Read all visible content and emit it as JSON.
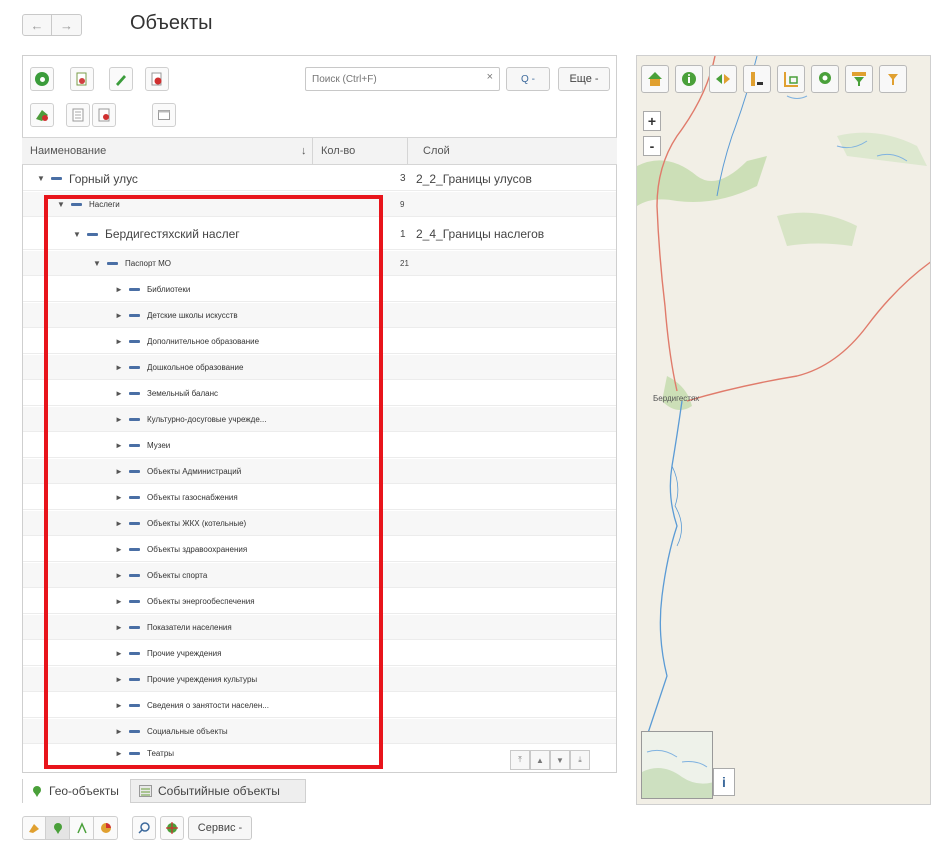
{
  "header": {
    "title": "Объекты",
    "back_icon": "←",
    "forward_icon": "→"
  },
  "toolbar": {
    "search_placeholder": "Поиск (Ctrl+F)",
    "search_clear": "×",
    "search_button_label": "Q -",
    "more_label": "Еще -"
  },
  "grid": {
    "columns": {
      "name": "Наименование",
      "sort_mark": "↓",
      "count": "Кол-во",
      "layer": "Слой"
    },
    "rows": [
      {
        "name": "Горный улус",
        "count": "3",
        "layer": "2_2_Границы улусов"
      },
      {
        "name": "Наслеги",
        "count": "9",
        "layer": ""
      },
      {
        "name": "Бердигестяхский наслег",
        "count": "1",
        "layer": "2_4_Границы наслегов"
      },
      {
        "name": "Паспорт МО",
        "count": "21",
        "layer": ""
      },
      {
        "name": "Библиотеки",
        "count": "",
        "layer": ""
      },
      {
        "name": "Детские школы искусств",
        "count": "",
        "layer": ""
      },
      {
        "name": "Дополнительное образование",
        "count": "",
        "layer": ""
      },
      {
        "name": "Дошкольное образование",
        "count": "",
        "layer": ""
      },
      {
        "name": "Земельный баланс",
        "count": "",
        "layer": ""
      },
      {
        "name": "Культурно-досуговые учрежде...",
        "count": "",
        "layer": ""
      },
      {
        "name": "Музеи",
        "count": "",
        "layer": ""
      },
      {
        "name": "Объекты Администраций",
        "count": "",
        "layer": ""
      },
      {
        "name": "Объекты газоснабжения",
        "count": "",
        "layer": ""
      },
      {
        "name": "Объекты ЖКХ (котельные)",
        "count": "",
        "layer": ""
      },
      {
        "name": "Объекты здравоохранения",
        "count": "",
        "layer": ""
      },
      {
        "name": "Объекты спорта",
        "count": "",
        "layer": ""
      },
      {
        "name": "Объекты энергообеспечения",
        "count": "",
        "layer": ""
      },
      {
        "name": "Показатели населения",
        "count": "",
        "layer": ""
      },
      {
        "name": "Прочие учреждения",
        "count": "",
        "layer": ""
      },
      {
        "name": "Прочие учреждения культуры",
        "count": "",
        "layer": ""
      },
      {
        "name": "Сведения о занятости населен...",
        "count": "",
        "layer": ""
      },
      {
        "name": "Социальные объекты",
        "count": "",
        "layer": ""
      },
      {
        "name": "Театры",
        "count": "",
        "layer": ""
      }
    ]
  },
  "tabs": {
    "geo": "Гео-объекты",
    "event": "Событийные объекты"
  },
  "bottom": {
    "service_label": "Сервис -"
  },
  "map": {
    "zoom_in": "+",
    "zoom_out": "-",
    "town_label": "Бердигестях",
    "info_label": "i"
  },
  "colors": {
    "highlight": "#e8141b",
    "tree_dash": "#4a6fa5",
    "border_line": "#e07b6b",
    "river": "#5b9bd5",
    "green_area": "#bcd9a3"
  }
}
